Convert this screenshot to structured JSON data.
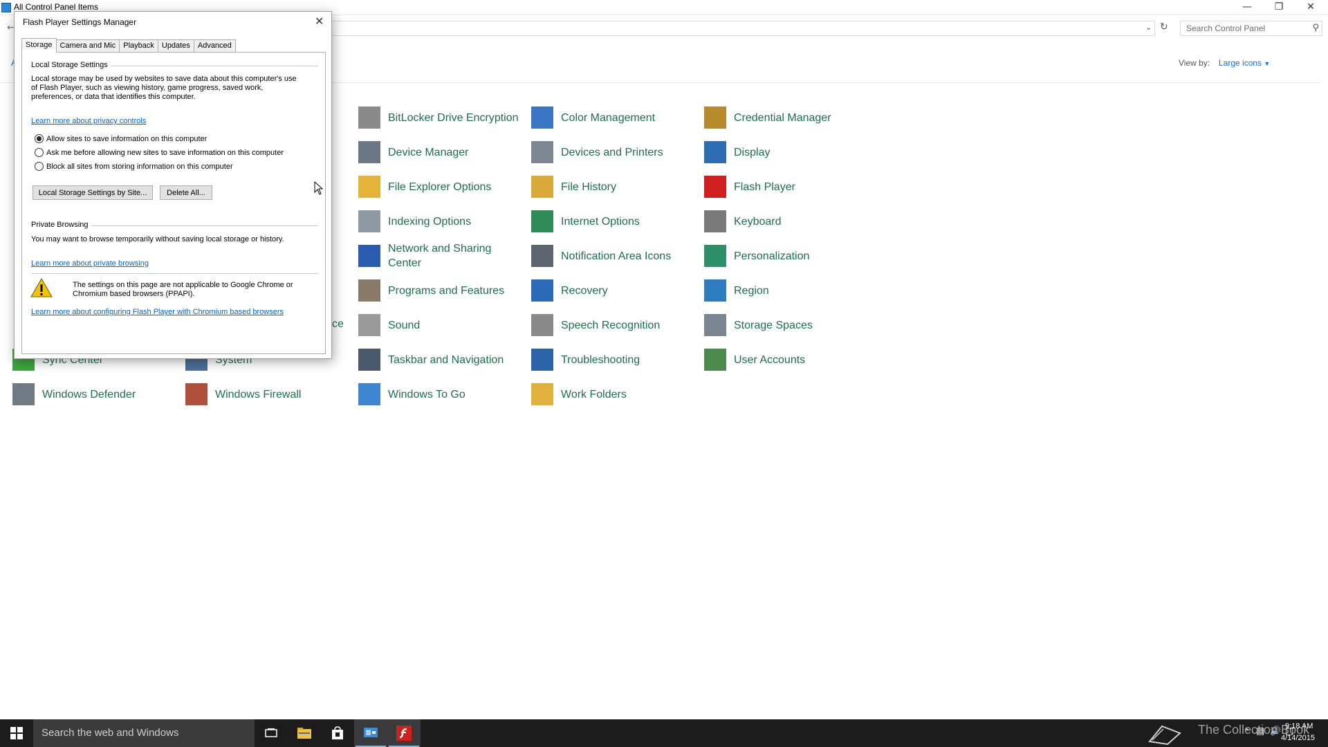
{
  "control_panel": {
    "title": "All Control Panel Items",
    "search_placeholder": "Search Control Panel",
    "view_by_label": "View by:",
    "view_by_value": "Large icons",
    "left_letter": "A",
    "items": [
      {
        "label": "BitLocker Drive Encryption",
        "icon": "bitlocker-icon",
        "color": "#8a8a8a"
      },
      {
        "label": "Color Management",
        "icon": "color-management-icon",
        "color": "#3a76c4"
      },
      {
        "label": "Credential Manager",
        "icon": "credential-manager-icon",
        "color": "#b58b2e"
      },
      {
        "label": "Device Manager",
        "icon": "device-manager-icon",
        "color": "#6b7785"
      },
      {
        "label": "Devices and Printers",
        "icon": "devices-printers-icon",
        "color": "#7d8794"
      },
      {
        "label": "Display",
        "icon": "display-icon",
        "color": "#2f6db3"
      },
      {
        "label": "File Explorer Options",
        "icon": "file-explorer-options-icon",
        "color": "#e2b43a"
      },
      {
        "label": "File History",
        "icon": "file-history-icon",
        "color": "#d9a93a"
      },
      {
        "label": "Flash Player",
        "icon": "flash-player-icon",
        "color": "#d01f1f"
      },
      {
        "label": "Indexing Options",
        "icon": "indexing-options-icon",
        "color": "#8f99a3"
      },
      {
        "label": "Internet Options",
        "icon": "internet-options-icon",
        "color": "#2e8b57"
      },
      {
        "label": "Keyboard",
        "icon": "keyboard-icon",
        "color": "#7a7a7a"
      },
      {
        "label": "Network and Sharing Center",
        "icon": "network-sharing-icon",
        "color": "#2a5db0"
      },
      {
        "label": "Notification Area Icons",
        "icon": "notification-area-icon",
        "color": "#5b6470"
      },
      {
        "label": "Personalization",
        "icon": "personalization-icon",
        "color": "#2f8f6a"
      },
      {
        "label": "Programs and Features",
        "icon": "programs-features-icon",
        "color": "#8a7a6a"
      },
      {
        "label": "Recovery",
        "icon": "recovery-icon",
        "color": "#2d6ab8"
      },
      {
        "label": "Region",
        "icon": "region-icon",
        "color": "#2e7dbf"
      },
      {
        "label": "Sound",
        "icon": "sound-icon",
        "color": "#9a9a9a"
      },
      {
        "label": "Speech Recognition",
        "icon": "speech-recognition-icon",
        "color": "#8a8a8a"
      },
      {
        "label": "Storage Spaces",
        "icon": "storage-spaces-icon",
        "color": "#7b8490"
      },
      {
        "label": "Taskbar and Navigation",
        "icon": "taskbar-navigation-icon",
        "color": "#4a5a6a"
      },
      {
        "label": "Troubleshooting",
        "icon": "troubleshooting-icon",
        "color": "#2c63a8"
      },
      {
        "label": "User Accounts",
        "icon": "user-accounts-icon",
        "color": "#4d8a4d"
      },
      {
        "label": "Sync Center",
        "icon": "sync-center-icon",
        "color": "#3ea63e"
      },
      {
        "label": "System",
        "icon": "system-icon",
        "color": "#4c6f9a"
      },
      {
        "label": "Windows Defender",
        "icon": "windows-defender-icon",
        "color": "#6f7a85"
      },
      {
        "label": "Windows Firewall",
        "icon": "windows-firewall-icon",
        "color": "#b0503a"
      },
      {
        "label": "Windows To Go",
        "icon": "windows-to-go-icon",
        "color": "#3f86d0"
      },
      {
        "label": "Work Folders",
        "icon": "work-folders-icon",
        "color": "#e0b13c"
      }
    ],
    "partial_label_fragment": "ce"
  },
  "flash_dialog": {
    "title": "Flash Player Settings Manager",
    "tabs": [
      "Storage",
      "Camera and Mic",
      "Playback",
      "Updates",
      "Advanced"
    ],
    "active_tab": "Storage",
    "local_storage": {
      "heading": "Local Storage Settings",
      "description_line1": "Local storage may be used by websites to save data about this computer's use",
      "description_line2": "of Flash Player, such as viewing history, game progress, saved work,",
      "description_line3": "preferences, or data that identifies this computer.",
      "privacy_link": "Learn more about privacy controls",
      "options": [
        {
          "label": "Allow sites to save information on this computer",
          "checked": true
        },
        {
          "label": "Ask me before allowing new sites to save information on this computer",
          "checked": false
        },
        {
          "label": "Block all sites from storing information on this computer",
          "checked": false
        }
      ],
      "by_site_button": "Local Storage Settings by Site...",
      "delete_all_button": "Delete All..."
    },
    "private_browsing": {
      "heading": "Private Browsing",
      "description": "You may want to browse temporarily without saving local storage or history.",
      "link": "Learn more about private browsing"
    },
    "warning": {
      "line1": "The settings on this page are not applicable to Google Chrome or",
      "line2": "Chromium based browsers (PPAPI).",
      "link": "Learn more about configuring Flash Player with Chromium based browsers"
    }
  },
  "taskbar": {
    "search_placeholder": "Search the web and Windows",
    "watermark": "The Collection Book",
    "clock_time": "9:18 AM",
    "clock_date": "4/14/2015"
  }
}
